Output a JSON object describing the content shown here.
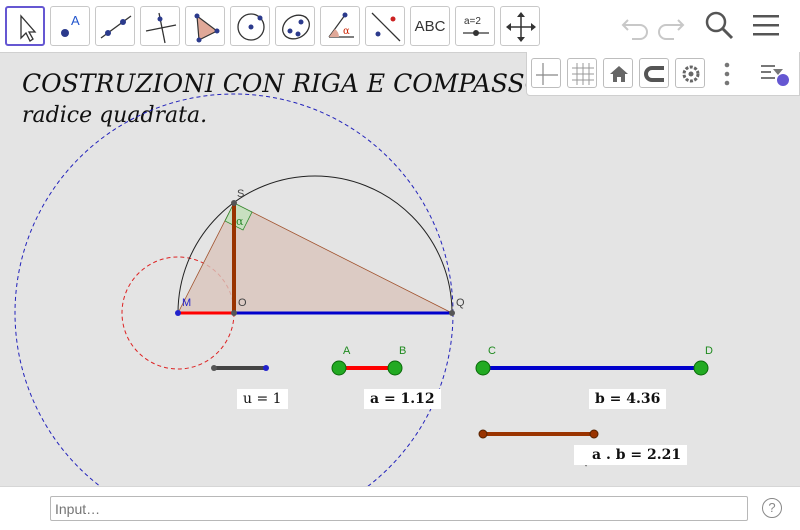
{
  "toolbar": {
    "tools": [
      {
        "id": "move",
        "name": "move-tool-icon",
        "active": true
      },
      {
        "id": "point",
        "name": "point-tool-icon",
        "active": false,
        "label": "A"
      },
      {
        "id": "line",
        "name": "line-tool-icon",
        "active": false
      },
      {
        "id": "perpendicular",
        "name": "perpendicular-line-tool-icon",
        "active": false
      },
      {
        "id": "polygon",
        "name": "polygon-tool-icon",
        "active": false
      },
      {
        "id": "circle",
        "name": "circle-tool-icon",
        "active": false
      },
      {
        "id": "ellipse",
        "name": "ellipse-tool-icon",
        "active": false
      },
      {
        "id": "angle",
        "name": "angle-tool-icon",
        "active": false,
        "label": "α"
      },
      {
        "id": "reflect",
        "name": "reflect-tool-icon",
        "active": false
      },
      {
        "id": "text",
        "name": "text-tool-icon",
        "active": false,
        "label": "ABC"
      },
      {
        "id": "slider",
        "name": "slider-tool-icon",
        "active": false,
        "label": "a=2"
      },
      {
        "id": "move-graphics",
        "name": "move-graphics-view-tool-icon",
        "active": false
      }
    ]
  },
  "title": {
    "line1": "COSTRUZIONI CON RIGA E COMPASSO:",
    "line2": "radice quadrata."
  },
  "points": {
    "S": "S",
    "M": "M",
    "O": "O",
    "Q": "Q",
    "A": "A",
    "B": "B",
    "C": "C",
    "D": "D"
  },
  "angle_label": "α",
  "values": {
    "u": "u = 1",
    "a": "a = 1.12",
    "b": "b = 4.36",
    "sqrt_ab": "a . b = 2.21"
  },
  "input": {
    "placeholder": "Input…",
    "value": ""
  },
  "help_label": "?",
  "colors": {
    "accent": "#6557d2",
    "segment_a": "#ff0000",
    "segment_b": "#0000cc",
    "segment_sqrt": "#993300",
    "segment_u": "#444444",
    "point_green": "#1e9e1e",
    "point_blue": "#2222cc",
    "canvas": "#e4e4e4"
  }
}
